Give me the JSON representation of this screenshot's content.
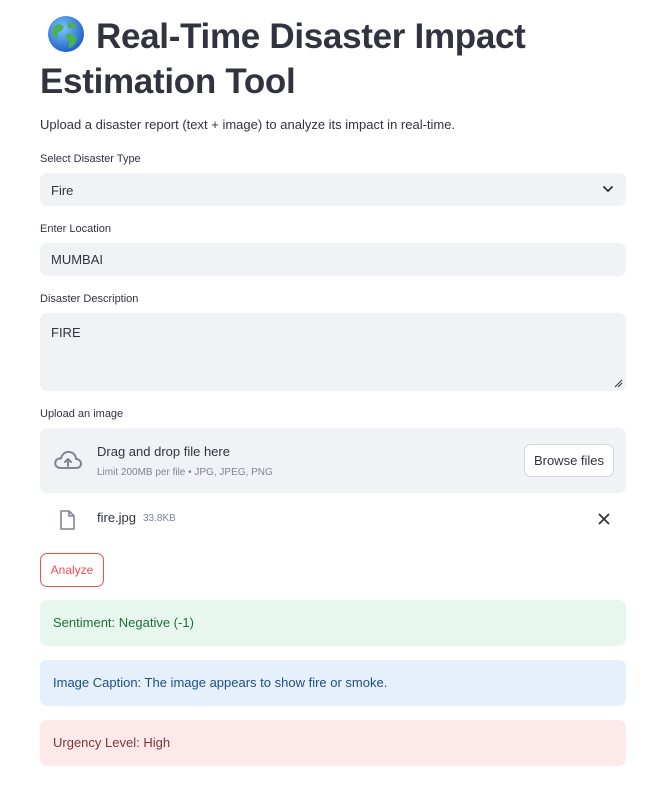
{
  "header": {
    "title": "Real-Time Disaster Impact Estimation Tool",
    "subtitle": "Upload a disaster report (text + image) to analyze its impact in real-time."
  },
  "form": {
    "disaster_type": {
      "label": "Select Disaster Type",
      "value": "Fire"
    },
    "location": {
      "label": "Enter Location",
      "value": "MUMBAI"
    },
    "description": {
      "label": "Disaster Description",
      "value": "FIRE"
    },
    "upload": {
      "label": "Upload an image",
      "drop_text": "Drag and drop file here",
      "limit_text": "Limit 200MB per file • JPG, JPEG, PNG",
      "browse_label": "Browse files",
      "file": {
        "name": "fire.jpg",
        "size": "33.8KB"
      }
    },
    "analyze_label": "Analyze"
  },
  "results": {
    "sentiment": "Sentiment: Negative (-1)",
    "caption": "Image Caption: The image appears to show fire or smoke.",
    "urgency": "Urgency Level: High"
  },
  "colors": {
    "primary": "#ff4b4b",
    "input_bg": "#f0f2f6",
    "success_bg": "#e8f7ed",
    "info_bg": "#e6f0fb",
    "error_bg": "#fde9ea"
  },
  "icons": [
    "globe-icon",
    "chevron-down-icon",
    "resize-handle-icon",
    "cloud-upload-icon",
    "file-icon",
    "close-icon"
  ]
}
